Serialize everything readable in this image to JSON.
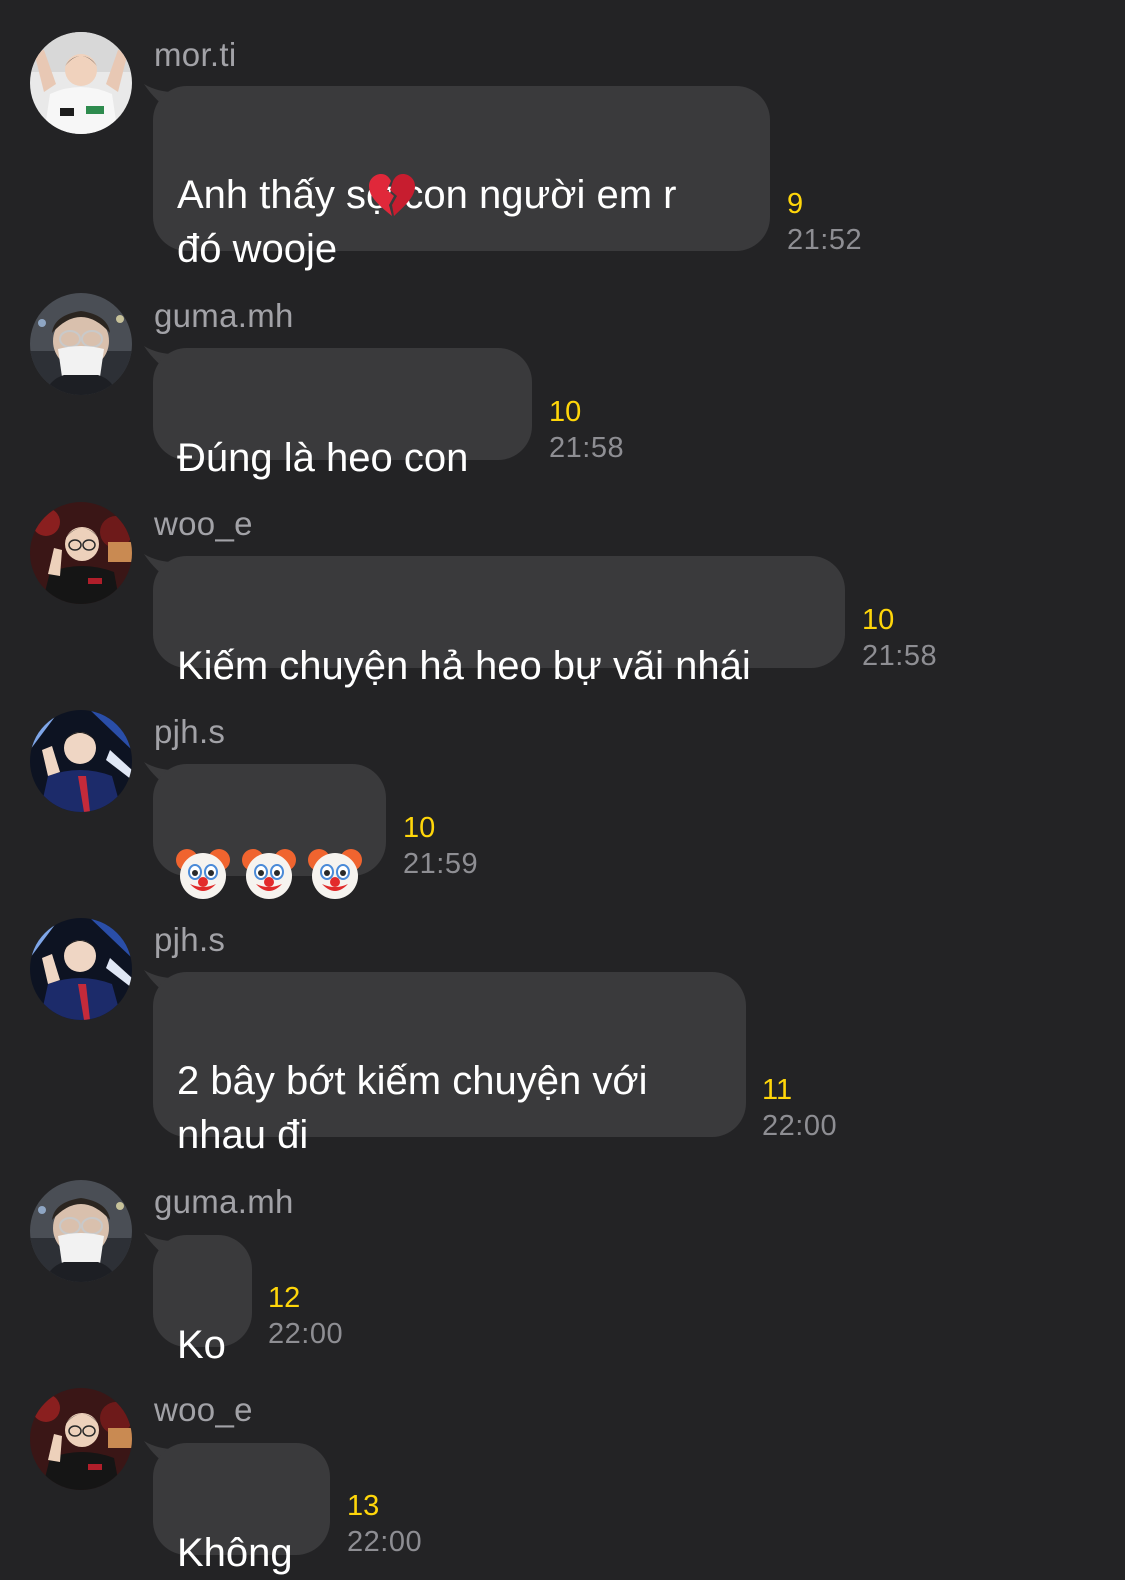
{
  "messages": [
    {
      "sender": "mor.ti",
      "avatar": "avatar-mor-ti",
      "text": "Anh thấy sợ con người em r\nđó wooje",
      "trailing_emoji": "broken-heart-icon",
      "read_count": "9",
      "time": "21:52"
    },
    {
      "sender": "guma.mh",
      "avatar": "avatar-guma-mh",
      "text": "Đúng là heo con",
      "read_count": "10",
      "time": "21:58"
    },
    {
      "sender": "woo_e",
      "avatar": "avatar-woo-e",
      "text": "Kiếm chuyện hả heo bự vãi nhái",
      "read_count": "10",
      "time": "21:58"
    },
    {
      "sender": "pjh.s",
      "avatar": "avatar-pjh-s",
      "emoji_only": [
        "clown-face-icon",
        "clown-face-icon",
        "clown-face-icon"
      ],
      "read_count": "10",
      "time": "21:59"
    },
    {
      "sender": "pjh.s",
      "avatar": "avatar-pjh-s",
      "text": "2 bây bớt kiếm chuyện với\nnhau đi",
      "read_count": "11",
      "time": "22:00"
    },
    {
      "sender": "guma.mh",
      "avatar": "avatar-guma-mh",
      "text": "Ko",
      "read_count": "12",
      "time": "22:00"
    },
    {
      "sender": "woo_e",
      "avatar": "avatar-woo-e",
      "text": "Không",
      "read_count": "13",
      "time": "22:00"
    }
  ],
  "colors": {
    "background": "#232325",
    "bubble": "#3a3a3c",
    "sender_name": "#a2a2a7",
    "read_count": "#ffd60a",
    "timestamp": "#8e8e93"
  }
}
